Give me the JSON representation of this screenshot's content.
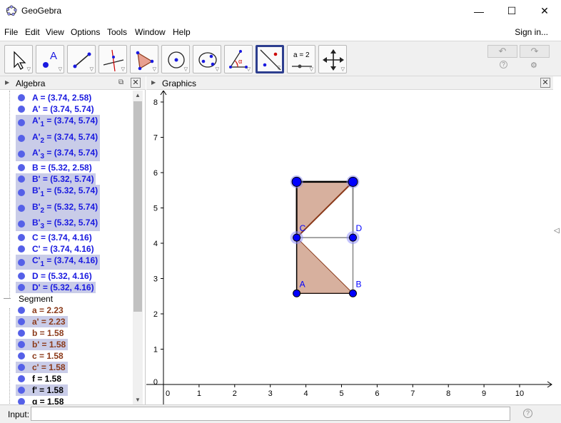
{
  "window": {
    "title": "GeoGebra",
    "minimize": "—",
    "maximize": "☐",
    "close": "✕"
  },
  "menu": {
    "items": [
      "File",
      "Edit",
      "View",
      "Options",
      "Tools",
      "Window",
      "Help"
    ],
    "signin": "Sign in..."
  },
  "toolbar": {
    "tools": [
      "move",
      "point",
      "line",
      "perpendicular-line",
      "polygon",
      "circle-center-point",
      "conic",
      "angle",
      "reflect-about-line",
      "slider",
      "move-graphics-view"
    ],
    "selected_tool": "reflect-about-line",
    "slider_label": "a = 2",
    "undo": "↶",
    "redo": "↷",
    "help": "?",
    "settings": "⚙"
  },
  "algebra": {
    "title": "Algebra",
    "rows": [
      {
        "label": "A = (3.74, 2.58)",
        "sel": false
      },
      {
        "label": "A' = (3.74, 5.74)",
        "sel": false
      },
      {
        "label_main": "A'",
        "sub": "1",
        "rest": " = (3.74, 5.74)",
        "sel": true
      },
      {
        "label_main": "A'",
        "sub": "2",
        "rest": " = (3.74, 5.74)",
        "sel": true
      },
      {
        "label_main": "A'",
        "sub": "3",
        "rest": " = (3.74, 5.74)",
        "sel": true
      },
      {
        "label": "B = (5.32, 2.58)",
        "sel": false
      },
      {
        "label": "B' = (5.32, 5.74)",
        "sel": true
      },
      {
        "label_main": "B'",
        "sub": "1",
        "rest": " = (5.32, 5.74)",
        "sel": true
      },
      {
        "label_main": "B'",
        "sub": "2",
        "rest": " = (5.32, 5.74)",
        "sel": true
      },
      {
        "label_main": "B'",
        "sub": "3",
        "rest": " = (5.32, 5.74)",
        "sel": true
      },
      {
        "label": "C = (3.74, 4.16)",
        "sel": false
      },
      {
        "label": "C' = (3.74, 4.16)",
        "sel": false
      },
      {
        "label_main": "C'",
        "sub": "1",
        "rest": " = (3.74, 4.16)",
        "sel": true
      },
      {
        "label": "D = (5.32, 4.16)",
        "sel": false
      },
      {
        "label": "D' = (5.32, 4.16)",
        "sel": true
      }
    ],
    "segment_group": "Segment",
    "segments": [
      {
        "label": "a = 2.23",
        "sel": false,
        "black": false
      },
      {
        "label": "a' = 2.23",
        "sel": true,
        "black": false
      },
      {
        "label": "b = 1.58",
        "sel": false,
        "black": false
      },
      {
        "label": "b' = 1.58",
        "sel": true,
        "black": false
      },
      {
        "label": "c = 1.58",
        "sel": false,
        "black": false
      },
      {
        "label": "c' = 1.58",
        "sel": true,
        "black": false
      },
      {
        "label": "f = 1.58",
        "sel": false,
        "black": true
      },
      {
        "label": "f' = 1.58",
        "sel": true,
        "black": true
      },
      {
        "label": "g = 1.58",
        "sel": false,
        "black": true
      }
    ]
  },
  "graphics": {
    "title": "Graphics",
    "x_ticks": [
      "0",
      "1",
      "2",
      "3",
      "4",
      "5",
      "6",
      "7",
      "8",
      "9",
      "10"
    ],
    "y_ticks": [
      "0",
      "1",
      "2",
      "3",
      "4",
      "5",
      "6",
      "7",
      "8"
    ],
    "points": [
      {
        "name": "A",
        "x": 3.74,
        "y": 2.58,
        "label": "A"
      },
      {
        "name": "B",
        "x": 5.32,
        "y": 2.58,
        "label": "B"
      },
      {
        "name": "C",
        "x": 3.74,
        "y": 4.16,
        "label": "C"
      },
      {
        "name": "D",
        "x": 5.32,
        "y": 4.16,
        "label": "D"
      },
      {
        "name": "A'",
        "x": 3.74,
        "y": 5.74,
        "label": ""
      },
      {
        "name": "B'",
        "x": 5.32,
        "y": 5.74,
        "label": ""
      }
    ],
    "fill_color": "#d7b09e",
    "edge_color": "#8b3a1a",
    "point_color": "#0000ff"
  },
  "input": {
    "label": "Input:",
    "value": "",
    "help": "?"
  }
}
